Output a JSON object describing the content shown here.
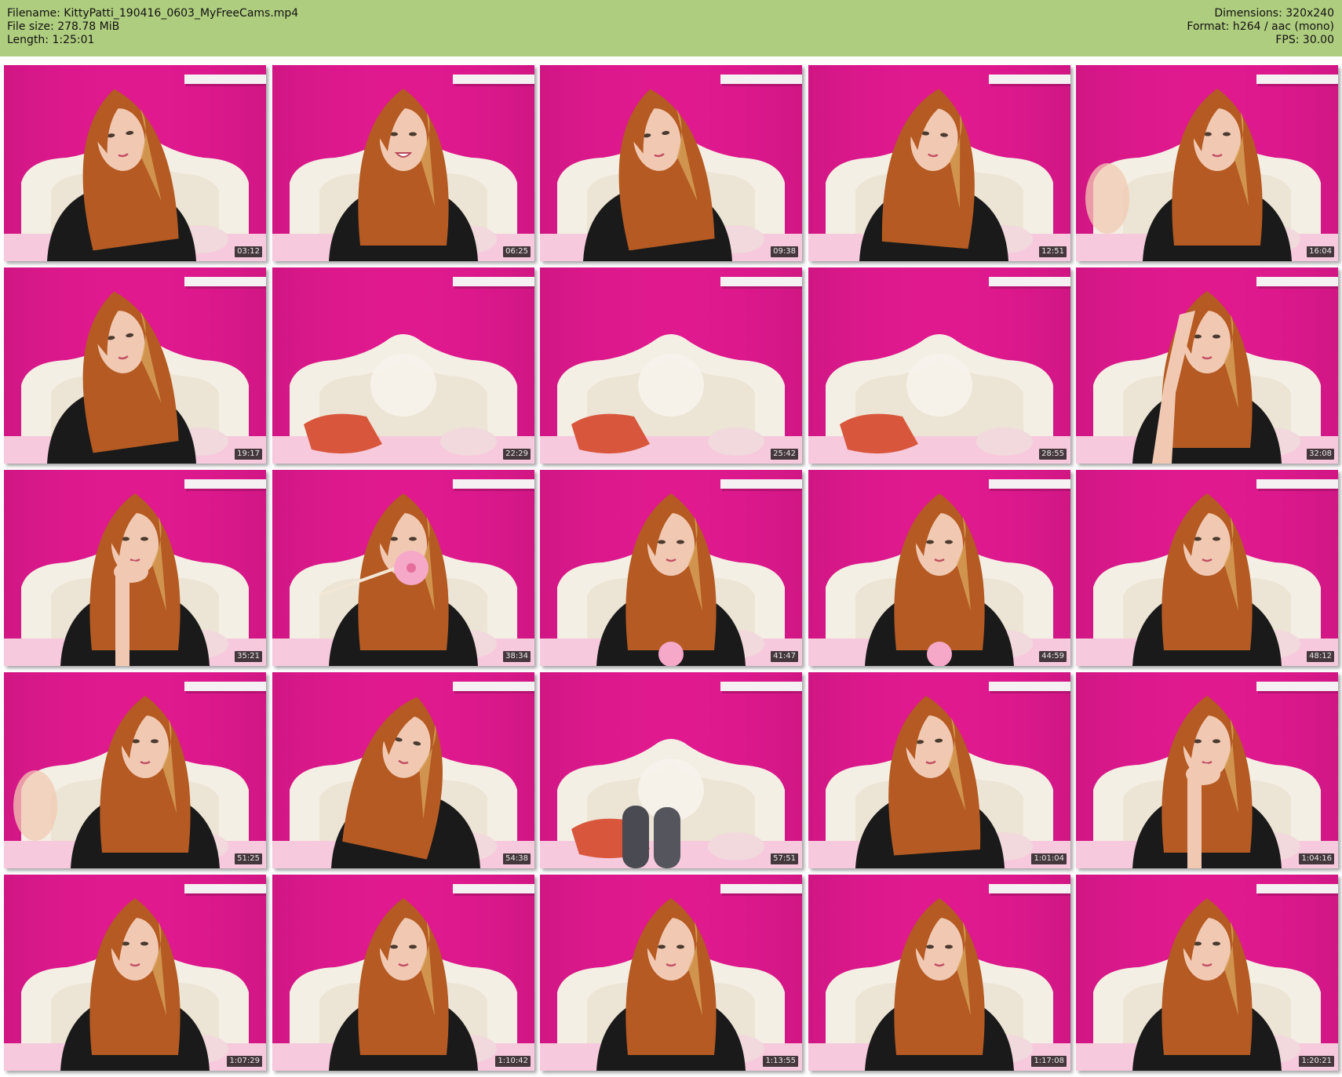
{
  "header": {
    "filename": "Filename: KittyPatti_190416_0603_MyFreeCams.mp4",
    "file_size": "File size: 278.78 MiB",
    "length": "Length: 1:25:01",
    "dimensions": "Dimensions: 320x240",
    "format": "Format: h264 / aac (mono)",
    "fps": "FPS: 30.00",
    "background_color": "#afcd7f"
  },
  "thumbnails": [
    {
      "time": "03:12",
      "person": true,
      "pose": "tilted"
    },
    {
      "time": "06:25",
      "person": true,
      "pose": "smiling"
    },
    {
      "time": "09:38",
      "person": true,
      "pose": "tilted"
    },
    {
      "time": "12:51",
      "person": true,
      "pose": "looking-away"
    },
    {
      "time": "16:04",
      "person": true,
      "pose": "hand-wave"
    },
    {
      "time": "19:17",
      "person": true,
      "pose": "tilted"
    },
    {
      "time": "22:29",
      "person": false,
      "pose": "empty-bed"
    },
    {
      "time": "25:42",
      "person": false,
      "pose": "empty-bed"
    },
    {
      "time": "28:55",
      "person": false,
      "pose": "empty-bed"
    },
    {
      "time": "32:08",
      "person": true,
      "pose": "hand-on-head"
    },
    {
      "time": "35:21",
      "person": true,
      "pose": "hand-on-chin"
    },
    {
      "time": "38:34",
      "person": true,
      "pose": "holding-flower"
    },
    {
      "time": "41:47",
      "person": true,
      "pose": "looking-down"
    },
    {
      "time": "44:59",
      "person": true,
      "pose": "looking-down"
    },
    {
      "time": "48:12",
      "person": true,
      "pose": "centered"
    },
    {
      "time": "51:25",
      "person": true,
      "pose": "hand-wave"
    },
    {
      "time": "54:38",
      "person": true,
      "pose": "head-tilt"
    },
    {
      "time": "57:51",
      "person": false,
      "pose": "legs"
    },
    {
      "time": "1:01:04",
      "person": true,
      "pose": "leaning"
    },
    {
      "time": "1:04:16",
      "person": true,
      "pose": "hand-on-mouth"
    },
    {
      "time": "1:07:29",
      "person": true,
      "pose": "centered"
    },
    {
      "time": "1:10:42",
      "person": true,
      "pose": "looking-down"
    },
    {
      "time": "1:13:55",
      "person": true,
      "pose": "looking-down"
    },
    {
      "time": "1:17:08",
      "person": true,
      "pose": "looking-down"
    },
    {
      "time": "1:20:21",
      "person": true,
      "pose": "centered"
    }
  ],
  "colors": {
    "wall": "#e0198f",
    "wall_dark": "#b3126f",
    "headboard": "#f4efe4",
    "bedding": "#f7c9dc",
    "pillow": "#d8573c",
    "hair": "#b45a22",
    "shirt": "#1a1a1a",
    "skin": "#f1c9b3",
    "stamp_bg": "#000000"
  }
}
